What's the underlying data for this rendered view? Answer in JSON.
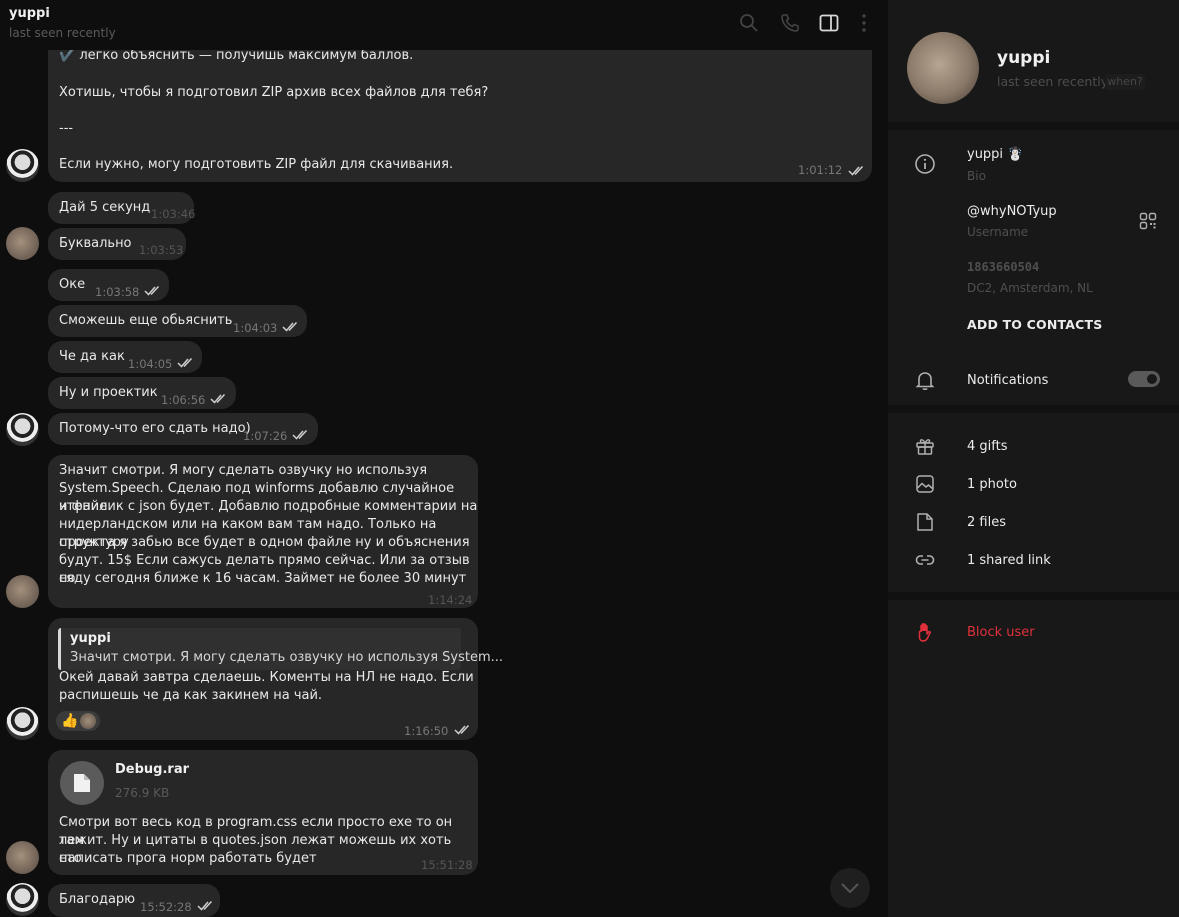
{
  "header": {
    "name": "yuppi",
    "status": "last seen recently"
  },
  "messages": {
    "big": {
      "line1": "✔️ легко объяснить — получишь максимум баллов.",
      "line2": "Хотишь, чтобы я подготовил ZIP архив всех файлов для тебя?",
      "line3": "---",
      "line4": "Если нужно, могу подготовить ZIP файл для скачивания.",
      "time": "1:01:12"
    },
    "m1": {
      "text": "Дай 5 секунд",
      "time": "1:03:46"
    },
    "m2": {
      "text": "Буквально",
      "time": "1:03:53"
    },
    "m3": {
      "text": "Оке",
      "time": "1:03:58"
    },
    "m4": {
      "text": "Сможешь еще обьяснить",
      "time": "1:04:03"
    },
    "m5": {
      "text": "Че да как",
      "time": "1:04:05"
    },
    "m6": {
      "text": "Ну и проектик",
      "time": "1:06:56"
    },
    "m7": {
      "text": "Потому-что его сдать надо)",
      "time": "1:07:26"
    },
    "m8": {
      "lines": [
        "Значит смотри. Я могу сделать озвучку но используя",
        "System.Speech. Сделаю под winforms добавлю случайное чтение",
        "и файлик с json будет. Добавлю подробные комментарии на",
        "нидерландском или на каком вам там надо. Только  на структуру",
        "проекта я забью все будет в одном файле ну и объяснения",
        "будут. 15$ Если сажусь делать прямо сейчас. Или за отзыв но",
        "сяду сегодня ближе к 16 часам. Займет не более 30 минут"
      ],
      "time": "1:14:24"
    },
    "m9": {
      "quote_name": "yuppi",
      "quote_text": "Значит смотри. Я могу сделать озвучку но используя System...",
      "line1": "Окей давай завтра сделаешь. Коменты на НЛ не надо. Если",
      "line2": "распишешь че да как закинем на чай.",
      "reaction": "👍",
      "time": "1:16:50"
    },
    "m10": {
      "file_name": "Debug.rar",
      "file_size": "276.9 KB",
      "line1": "Смотри вот весь код в program.css если просто exe то он там",
      "line2": "лежит. Ну и цитаты в quotes.json лежат можешь их хоть сто",
      "line3": "написать прога норм работать будет",
      "time": "15:51:28"
    },
    "m11": {
      "text": "Благодарю",
      "time": "15:52:28"
    }
  },
  "panel": {
    "name": "yuppi",
    "status": "last seen recently",
    "when": "when?",
    "bio": "yuppi ☃️",
    "bio_label": "Bio",
    "username": "@whyNOTyup",
    "username_label": "Username",
    "user_id": "1863660504",
    "dc": "DC2, Amsterdam, NL",
    "add_contacts": "ADD TO CONTACTS",
    "notifications": "Notifications",
    "notifications_on": true,
    "gifts": "4 gifts",
    "photo": "1 photo",
    "files": "2 files",
    "shared_link": "1 shared link",
    "block": "Block user"
  },
  "colors": {
    "background": "#0e0e0e",
    "bubble": "#272727",
    "panel": "#181818",
    "danger": "#e0313a"
  }
}
